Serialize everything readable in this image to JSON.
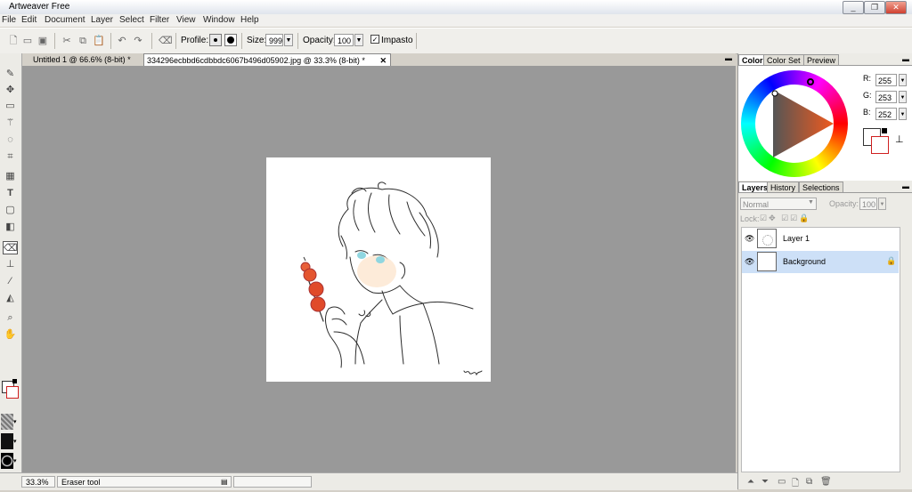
{
  "app": {
    "title": "Artweaver Free"
  },
  "window_controls": {
    "minimize": "_",
    "restore": "❐",
    "close": "✕"
  },
  "menu": [
    "File",
    "Edit",
    "Document",
    "Layer",
    "Select",
    "Filter",
    "View",
    "Window",
    "Help"
  ],
  "toolbar": {
    "profile_label": "Profile:",
    "size_label": "Size:",
    "size_value": "999",
    "opacity_label": "Opacity:",
    "opacity_value": "100",
    "impasto_label": "Impasto",
    "impasto_checked": true,
    "icons": [
      "new-icon",
      "open-icon",
      "save-icon",
      "cut-icon",
      "copy-icon",
      "paste-icon",
      "undo-icon",
      "redo-icon",
      "eraser-icon"
    ]
  },
  "tabs": [
    {
      "label": "Untitled 1 @ 66.6% (8-bit) *",
      "active": false
    },
    {
      "label": "334296ecbbd6cdbbdc6067b496d05902.jpg @ 33.3% (8-bit) *",
      "active": true
    }
  ],
  "status": {
    "zoom": "33.3%",
    "tool": "Eraser tool"
  },
  "color_panel": {
    "tabs": [
      "Color",
      "Color Set",
      "Preview"
    ],
    "r": "255",
    "g": "253",
    "b": "252",
    "r_label": "R:",
    "g_label": "G:",
    "b_label": "B:",
    "foreground": "#ffffff",
    "background": "#ffffff"
  },
  "layers_panel": {
    "tabs": [
      "Layers",
      "History",
      "Selections"
    ],
    "blend_mode": "Normal",
    "opacity_label": "Opacity:",
    "opacity_value": "100",
    "lock_label": "Lock:",
    "layers": [
      {
        "name": "Layer 1",
        "selected": false,
        "locked": false
      },
      {
        "name": "Background",
        "selected": true,
        "locked": true
      }
    ]
  },
  "colors": {
    "canvas_bg": "#999999",
    "selected_layer": "#cde0f7",
    "accent_red": "#e04a2a"
  }
}
